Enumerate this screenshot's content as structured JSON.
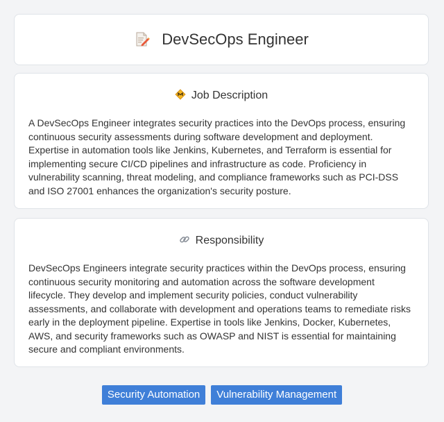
{
  "header": {
    "title": "DevSecOps Engineer",
    "icon": "document-pencil-icon"
  },
  "job_description": {
    "icon": "job-description-icon",
    "title": "Job Description",
    "body": "A DevSecOps Engineer integrates security practices into the DevOps process, ensuring continuous security assessments during software development and deployment. Expertise in automation tools like Jenkins, Kubernetes, and Terraform is essential for implementing secure CI/CD pipelines and infrastructure as code. Proficiency in vulnerability scanning, threat modeling, and compliance frameworks such as PCI-DSS and ISO 27001 enhances the organization's security posture."
  },
  "responsibility": {
    "icon": "link-icon",
    "title": "Responsibility",
    "body": "DevSecOps Engineers integrate security practices within the DevOps process, ensuring continuous security monitoring and automation across the software development lifecycle. They develop and implement security policies, conduct vulnerability assessments, and collaborate with development and operations teams to remediate risks early in the deployment pipeline. Expertise in tools like Jenkins, Docker, Kubernetes, AWS, and security frameworks such as OWASP and NIST is essential for maintaining secure and compliant environments."
  },
  "tags": [
    "Security Automation",
    "Vulnerability Management"
  ],
  "colors": {
    "tag_background": "#3f7fd8",
    "page_background": "#f3f4f6",
    "card_background": "#ffffff"
  }
}
